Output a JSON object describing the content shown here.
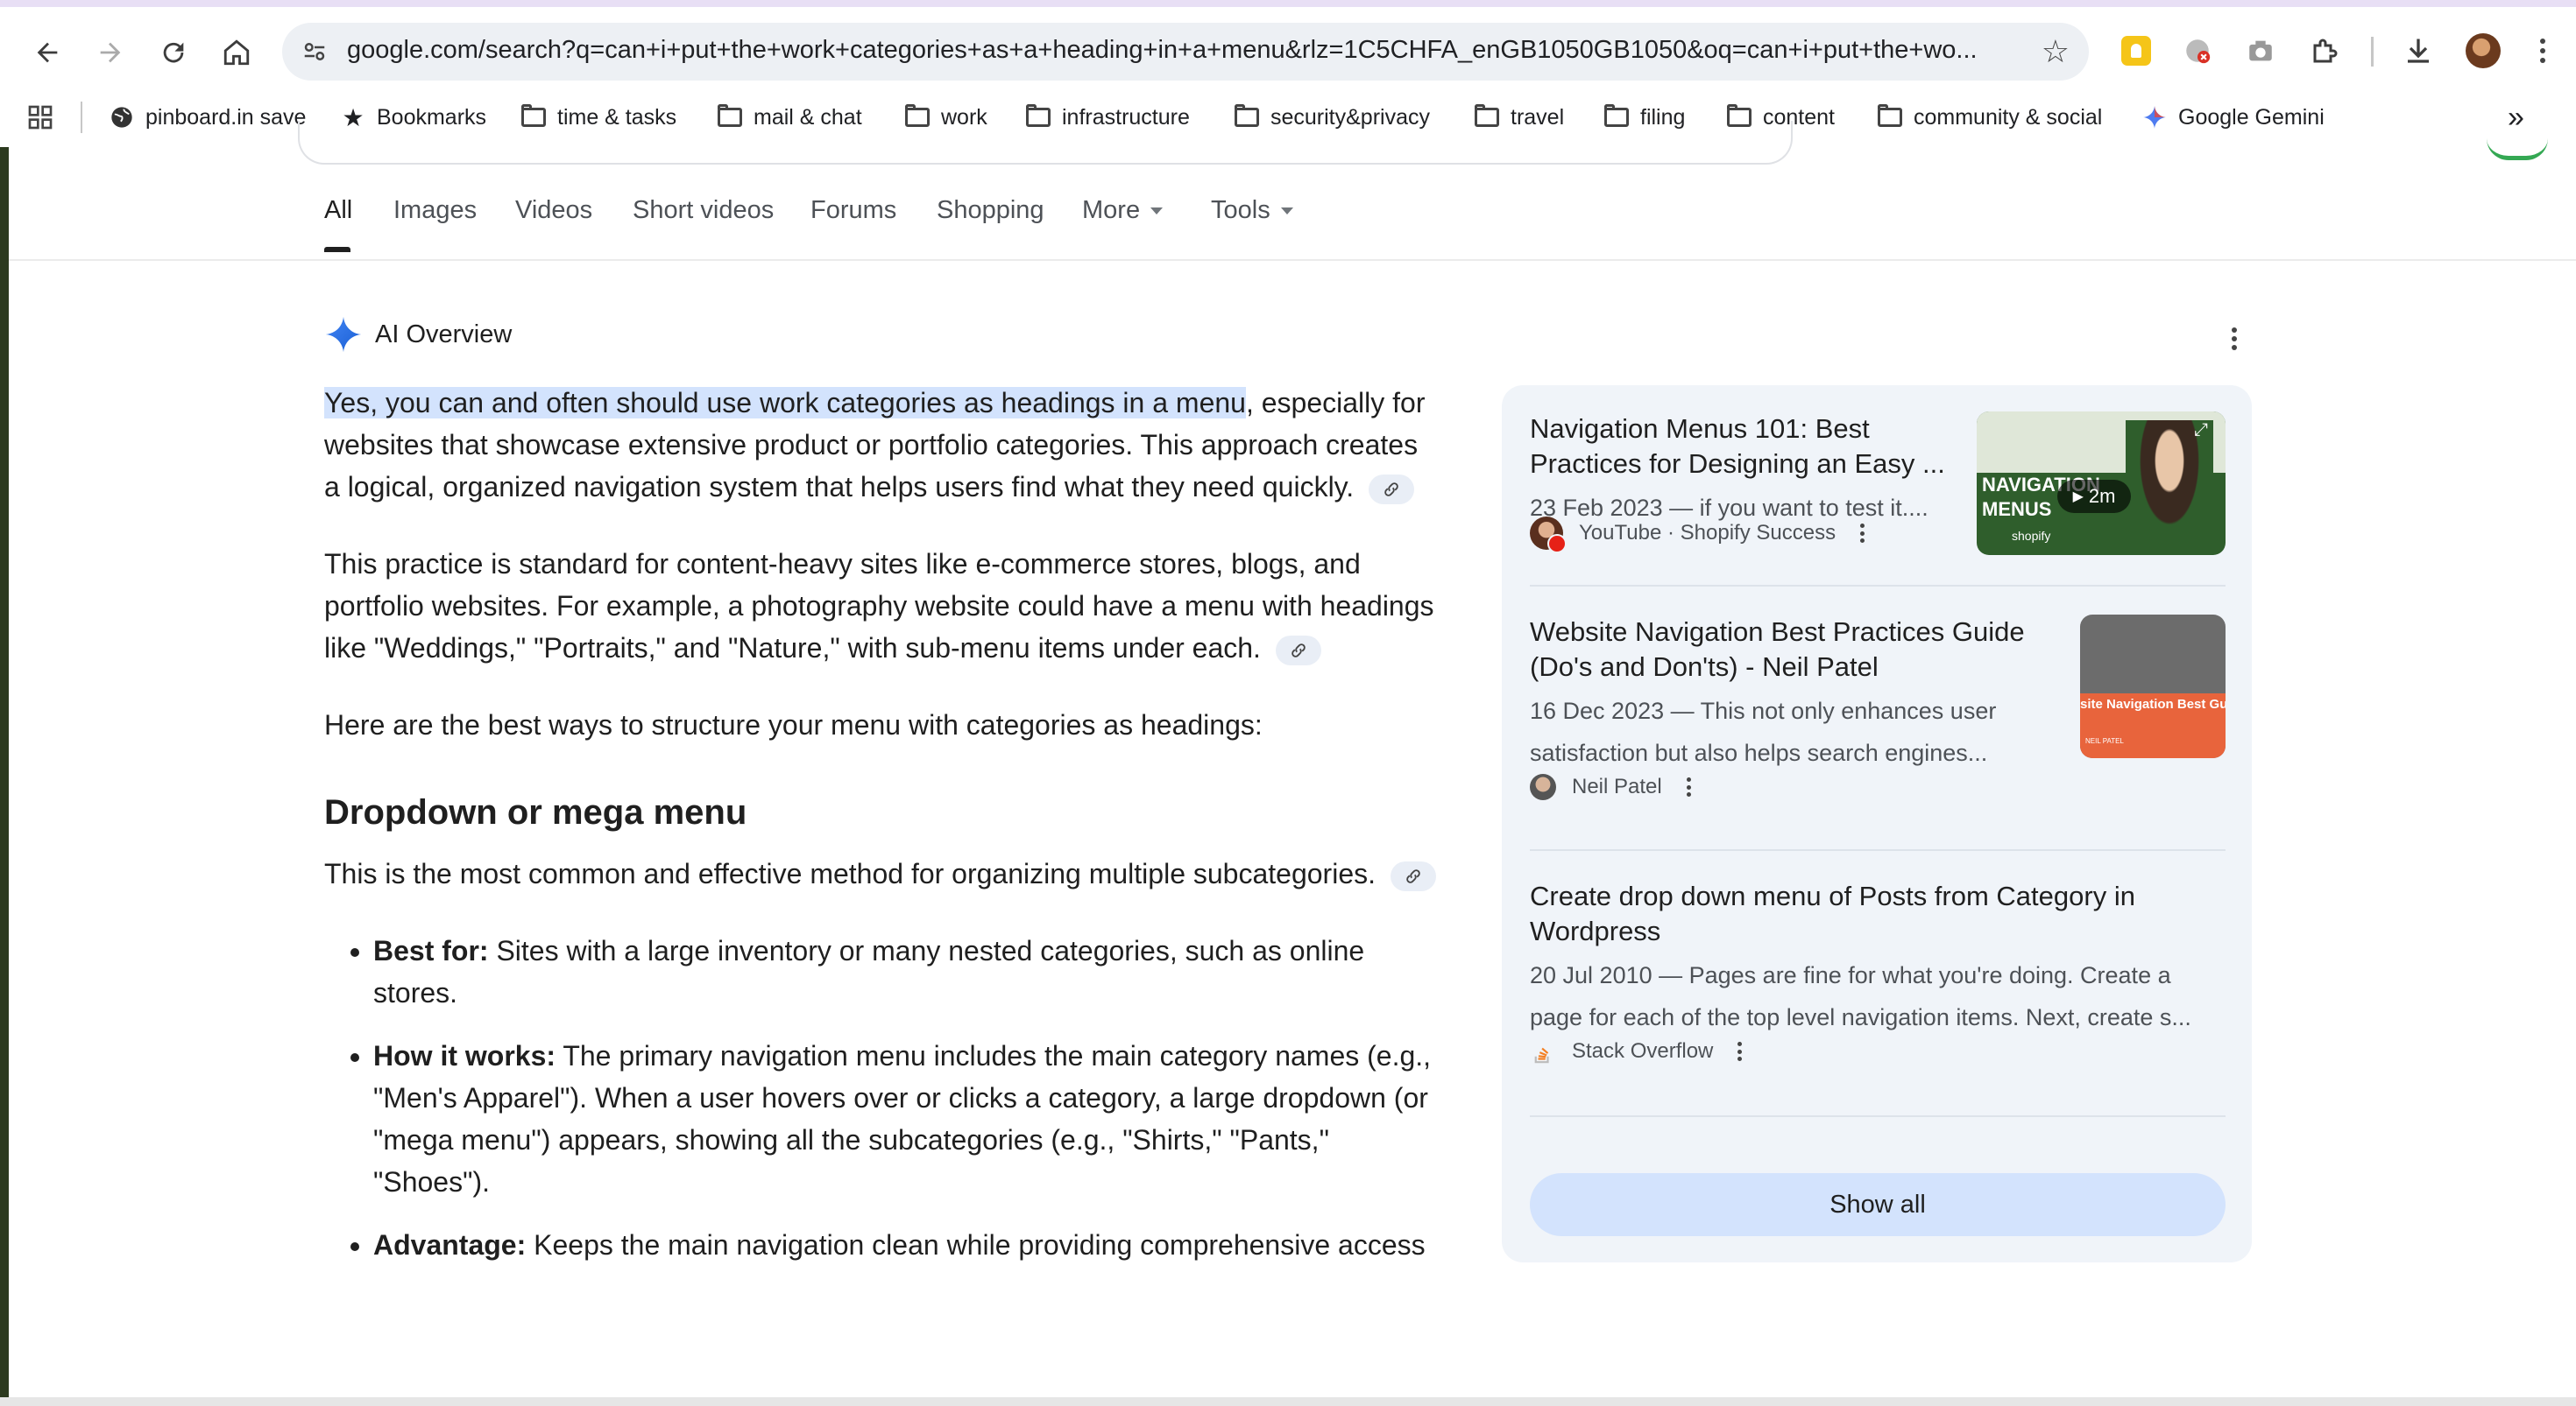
{
  "browser": {
    "url": "google.com/search?q=can+i+put+the+work+categories+as+a+heading+in+a+menu&rlz=1C5CHFA_enGB1050GB1050&oq=can+i+put+the+wo..."
  },
  "bookmarks": [
    {
      "label": "pinboard.in save",
      "icon": "globe-icon"
    },
    {
      "label": "Bookmarks",
      "icon": "star-icon"
    },
    {
      "label": "time & tasks",
      "icon": "folder-icon"
    },
    {
      "label": "mail & chat",
      "icon": "folder-icon"
    },
    {
      "label": "work",
      "icon": "folder-icon"
    },
    {
      "label": "infrastructure",
      "icon": "folder-icon"
    },
    {
      "label": "security&privacy",
      "icon": "folder-icon"
    },
    {
      "label": "travel",
      "icon": "folder-icon"
    },
    {
      "label": "filing",
      "icon": "folder-icon"
    },
    {
      "label": "content",
      "icon": "folder-icon"
    },
    {
      "label": "community & social",
      "icon": "folder-icon"
    },
    {
      "label": "Google Gemini",
      "icon": "gemini-icon"
    }
  ],
  "tabs": [
    "All",
    "Images",
    "Videos",
    "Short videos",
    "Forums",
    "Shopping",
    "More",
    "Tools"
  ],
  "ai_overview": {
    "title": "AI Overview",
    "p1_highlight": "Yes, you can and often should use work categories as headings in a menu",
    "p1_rest": ", especially for websites that showcase extensive product or portfolio categories. This approach creates a logical, organized navigation system that helps users find what they need quickly.",
    "p2": "This practice is standard for content-heavy sites like e-commerce stores, blogs, and portfolio websites. For example, a photography website could have a menu with headings like \"Weddings,\" \"Portraits,\" and \"Nature,\" with sub-menu items under each.",
    "p3": "Here are the best ways to structure your menu with categories as headings:",
    "h_dropdown": "Dropdown or mega menu",
    "p4": "This is the most common and effective method for organizing multiple subcategories.",
    "bullets": [
      {
        "label": "Best for:",
        "text": " Sites with a large inventory or many nested categories, such as online stores."
      },
      {
        "label": "How it works:",
        "text": " The primary navigation menu includes the main category names (e.g., \"Men's Apparel\"). When a user hovers over or clicks a category, a large dropdown (or \"mega menu\") appears, showing all the subcategories (e.g., \"Shirts,\" \"Pants,\" \"Shoes\")."
      },
      {
        "label": "Advantage:",
        "text": " Keeps the main navigation clean while providing comprehensive access"
      }
    ]
  },
  "sources": [
    {
      "title": "Navigation Menus 101: Best Practices for Designing an Easy ...",
      "snippet": "23 Feb 2023 — if you want to test it....",
      "site": "YouTube · Shopify Success",
      "thumb_label": "NAVIGATION MENUS",
      "thumb_sub": "shopify",
      "duration": "2m"
    },
    {
      "title": "Website Navigation Best Practices Guide (Do's and Don'ts) - Neil Patel",
      "snippet": "16 Dec 2023 — This not only enhances user satisfaction but also helps search engines...",
      "site": "Neil Patel",
      "thumb_label": "site Navigation Best Guide (Do's and Don'ts)",
      "thumb_sub": "NEIL PATEL"
    },
    {
      "title": "Create drop down menu of Posts from Category in Wordpress",
      "snippet": "20 Jul 2010 — Pages are fine for what you're doing. Create a page for each of the top level navigation items. Next, create s...",
      "site": "Stack Overflow"
    }
  ],
  "show_all": "Show all",
  "colors": {
    "highlight": "#d3e3fd",
    "panel_bg": "#f0f4f9",
    "accent_blue": "#1a73e8",
    "thumb_green": "#2f5e2c",
    "thumb_orange": "#e8643c"
  }
}
